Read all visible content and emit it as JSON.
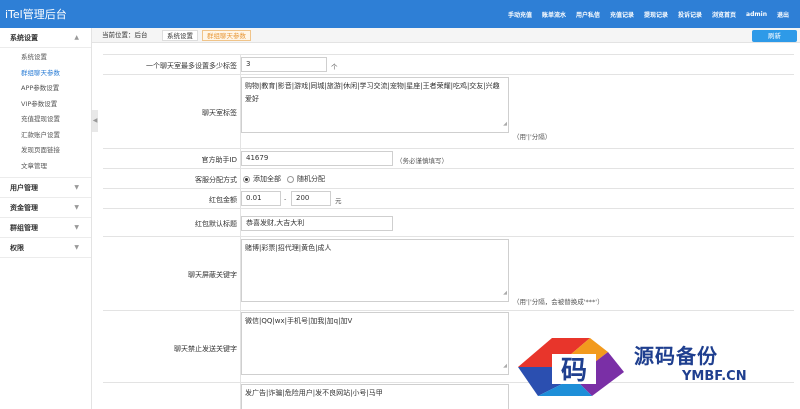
{
  "app": {
    "title": "iTel管理后台"
  },
  "topnav": [
    "手动充值",
    "账单流水",
    "用户私信",
    "充值记录",
    "提现记录",
    "投诉记录",
    "浏览首页",
    "admin",
    "退出"
  ],
  "sidebar": {
    "groups": [
      {
        "label": "系统设置",
        "items": [
          "系统设置",
          "群组聊天参数",
          "APP参数设置",
          "VIP参数设置",
          "充值提现设置",
          "汇款账户设置",
          "发现页面链接",
          "文章管理"
        ],
        "active_index": 1
      },
      {
        "label": "用户管理"
      },
      {
        "label": "资金管理"
      },
      {
        "label": "群组管理"
      },
      {
        "label": "权限"
      }
    ]
  },
  "breadcrumb": {
    "prefix": "当前位置：后台",
    "section": "系统设置",
    "current": "群组聊天参数"
  },
  "refresh_label": "刷新",
  "form": {
    "max_tags": {
      "label": "一个聊天室最多设置多少标签",
      "value": "3",
      "suffix": "个"
    },
    "room_tags": {
      "label": "聊天室标签",
      "value": "购物|教育|影音|游戏|同城|旅游|休闲|学习交流|宠物|星座|王者荣耀|吃鸡|交友|兴趣爱好",
      "hint": "（用'|'分隔）"
    },
    "assistant_id": {
      "label": "官方助手ID",
      "value": "41679",
      "hint": "（务必谨慎填写）"
    },
    "service_mode": {
      "label": "客服分配方式",
      "options": [
        "添加全部",
        "随机分配"
      ],
      "selected": 0
    },
    "red_packet_amount": {
      "label": "红包金额",
      "min": "0.01",
      "sep": "-",
      "max": "200",
      "unit": "元"
    },
    "red_packet_title": {
      "label": "红包默认标题",
      "value": "恭喜发财,大吉大利"
    },
    "blocked_words": {
      "label": "聊天屏蔽关键字",
      "value": "赌博|彩票|招代理|黄色|成人",
      "hint": "（用'|'分隔，会被替换成'***'）"
    },
    "banned_words": {
      "label": "聊天禁止发送关键字",
      "value": "微信|QQ|wx|手机号|加我|加q|加V"
    },
    "report_reasons": {
      "value": "发广告|诈骗|危险用户|发不良网站|小号|马甲"
    }
  },
  "watermark": {
    "text": "源码备份",
    "url": "YMBF.CN",
    "glyph": "码"
  },
  "colors": {
    "topbar": "#2e7fd6",
    "accent": "#2e7fd6",
    "current_tab": "#e89a3c",
    "refresh": "#2e9ae8",
    "watermark": "#1f3f8f"
  }
}
